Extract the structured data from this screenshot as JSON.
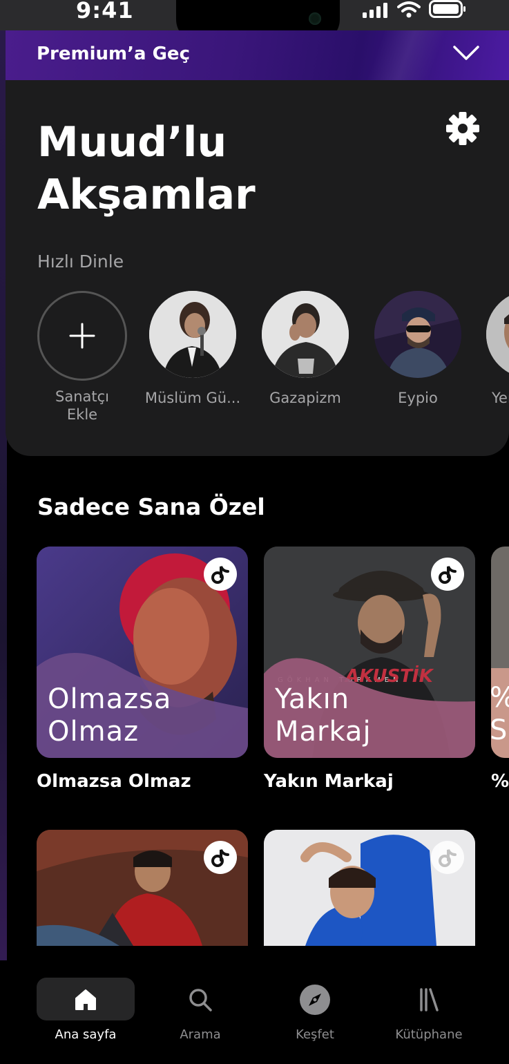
{
  "status_bar": {
    "time": "9:41",
    "icons": [
      "signal-icon",
      "wifi-icon",
      "battery-icon"
    ]
  },
  "premium_banner": {
    "label": "Premium’a Geç",
    "icon": "chevron-down-icon"
  },
  "header": {
    "title": "Muud’lu Akşamlar",
    "settings_icon": "gear-icon"
  },
  "quick_listen": {
    "label": "Hızlı Dinle",
    "add_artist": {
      "line1": "Sanatçı",
      "line2": "Ekle",
      "icon": "plus-icon"
    },
    "artists": [
      {
        "name": "Müslüm Gü..."
      },
      {
        "name": "Gazapizm"
      },
      {
        "name": "Eypio"
      },
      {
        "name": "Yer"
      }
    ]
  },
  "for_you": {
    "title": "Sadece Sana Özel",
    "cards": [
      {
        "cover_line1": "Olmazsa",
        "cover_line2": "Olmaz",
        "caption": "Olmazsa Olmaz",
        "cover_line3": ""
      },
      {
        "cover_line1": "Yakın",
        "cover_line2": "Markaj",
        "caption": "Yakın Markaj",
        "album_text": "GÖKHAN TÜRKMEN",
        "album_text2": "AKUSTİK"
      },
      {
        "cover_line1": "%",
        "cover_line2": "S",
        "caption": "%T"
      }
    ]
  },
  "tabs": [
    {
      "label": "Ana sayfa",
      "icon": "home-icon",
      "active": true
    },
    {
      "label": "Arama",
      "icon": "search-icon",
      "active": false
    },
    {
      "label": "Keşfet",
      "icon": "compass-icon",
      "active": false
    },
    {
      "label": "Kütüphane",
      "icon": "library-icon",
      "active": false
    }
  ],
  "colors": {
    "accent": "#4a1d8c",
    "card_bg": "#1c1c1d",
    "wave_purple": "#6a4a88",
    "wave_pink": "#9c5a7a"
  }
}
